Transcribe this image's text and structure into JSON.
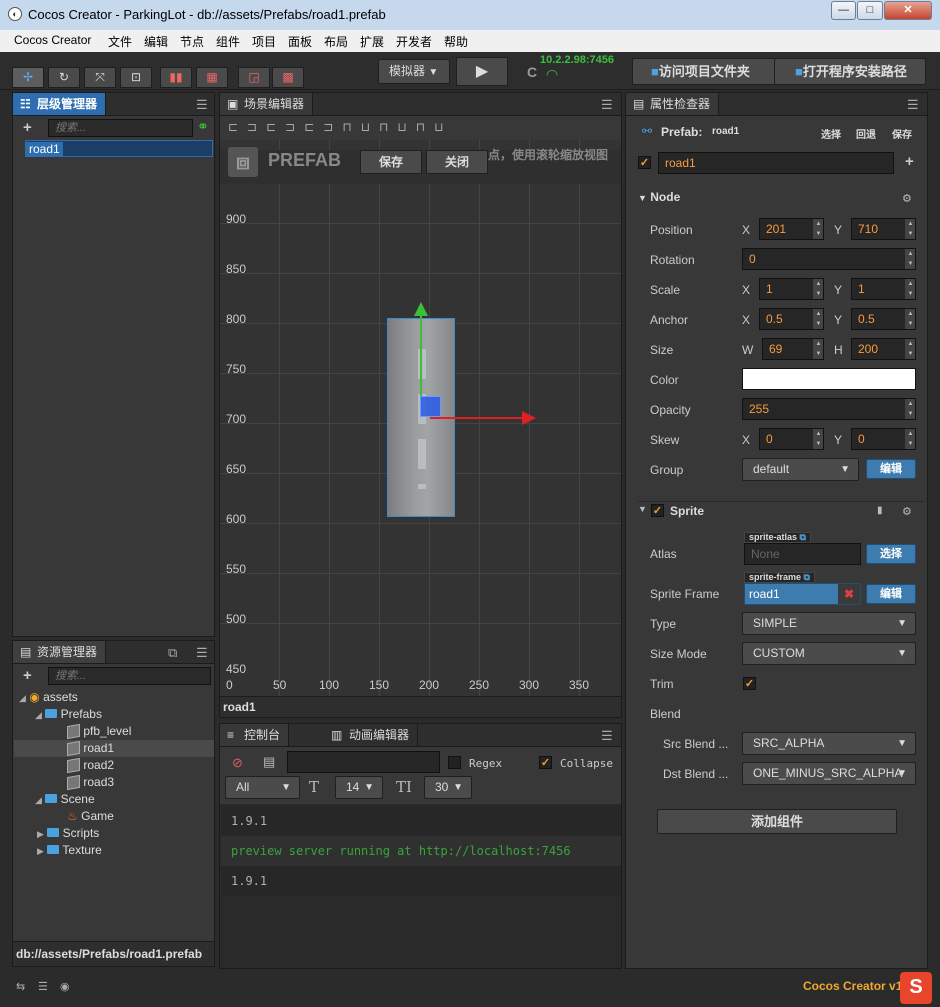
{
  "window": {
    "title": "Cocos Creator - ParkingLot - db://assets/Prefabs/road1.prefab",
    "min": "—",
    "max": "□",
    "close": "✕"
  },
  "menu": [
    "Cocos Creator",
    "文件",
    "编辑",
    "节点",
    "组件",
    "项目",
    "面板",
    "布局",
    "扩展",
    "开发者",
    "帮助"
  ],
  "toolbar": {
    "tools": [
      "✢",
      "↻",
      "⤧",
      "⊡"
    ],
    "platform": "模拟器",
    "play": "▶",
    "refresh": "C",
    "ip": "10.2.2.98:7456",
    "open_project_dir": "访问项目文件夹",
    "open_install_dir": "打开程序安装路径"
  },
  "hierarchy": {
    "tab": "层级管理器",
    "search_placeholder": "搜索...",
    "nodes": [
      "road1"
    ]
  },
  "assets": {
    "tab": "资源管理器",
    "search_placeholder": "搜索...",
    "tree": {
      "root": "assets",
      "prefabs": "Prefabs",
      "pfb_level": "pfb_level",
      "road1": "road1",
      "road2": "road2",
      "road3": "road3",
      "scene": "Scene",
      "game": "Game",
      "scripts": "Scripts",
      "texture": "Texture"
    },
    "path": "db://assets/Prefabs/road1.prefab"
  },
  "scene": {
    "tab": "场景编辑器",
    "prefab_watermark": "PREFAB",
    "save": "保存",
    "close": "关闭",
    "hint": "点，使用滚轮缩放视图",
    "y_ticks": [
      "900",
      "850",
      "800",
      "750",
      "700",
      "650",
      "600",
      "550",
      "500",
      "450"
    ],
    "x_ticks": [
      "0",
      "50",
      "100",
      "150",
      "200",
      "250",
      "300",
      "350"
    ],
    "node_name": "road1"
  },
  "console": {
    "tab": "控制台",
    "anim_tab": "动画编辑器",
    "regex": "Regex",
    "collapse": "Collapse",
    "filter": "All",
    "font_size": "14",
    "line_height": "30",
    "lines": [
      {
        "text": "1.9.1",
        "color": "#b0b0b0"
      },
      {
        "text": "preview server running at http://localhost:7456",
        "color": "#3aa33a"
      },
      {
        "text": "1.9.1",
        "color": "#b0b0b0"
      }
    ]
  },
  "inspector": {
    "tab": "属性检查器",
    "prefab_label": "Prefab:",
    "prefab_name": "road1",
    "select": "选择",
    "revert": "回退",
    "save": "保存",
    "node_name": "road1",
    "node_section": "Node",
    "position": {
      "label": "Position",
      "x": "201",
      "y": "710"
    },
    "rotation": {
      "label": "Rotation",
      "value": "0"
    },
    "scale": {
      "label": "Scale",
      "x": "1",
      "y": "1"
    },
    "anchor": {
      "label": "Anchor",
      "x": "0.5",
      "y": "0.5"
    },
    "size": {
      "label": "Size",
      "w": "69",
      "h": "200"
    },
    "color": {
      "label": "Color",
      "value": "#ffffff"
    },
    "opacity": {
      "label": "Opacity",
      "value": "255"
    },
    "skew": {
      "label": "Skew",
      "x": "0",
      "y": "0"
    },
    "group": {
      "label": "Group",
      "value": "default",
      "edit": "编辑"
    },
    "sprite_section": "Sprite",
    "atlas": {
      "label": "Atlas",
      "tag": "sprite-atlas",
      "value": "None",
      "button": "选择"
    },
    "sprite_frame": {
      "label": "Sprite Frame",
      "tag": "sprite-frame",
      "value": "road1",
      "button": "编辑"
    },
    "type": {
      "label": "Type",
      "value": "SIMPLE"
    },
    "size_mode": {
      "label": "Size Mode",
      "value": "CUSTOM"
    },
    "trim": {
      "label": "Trim"
    },
    "blend": {
      "label": "Blend"
    },
    "src_blend": {
      "label": "Src Blend ...",
      "value": "SRC_ALPHA"
    },
    "dst_blend": {
      "label": "Dst Blend ...",
      "value": "ONE_MINUS_SRC_ALPHA"
    },
    "add_component": "添加组件",
    "axis": {
      "x": "X",
      "y": "Y",
      "w": "W",
      "h": "H"
    }
  },
  "statusbar": {
    "version": "Cocos Creator v1.9.1"
  },
  "colors": {
    "accent": "#2e6eb0",
    "orange": "#f89c3e",
    "selection": "#1f5ea8"
  }
}
